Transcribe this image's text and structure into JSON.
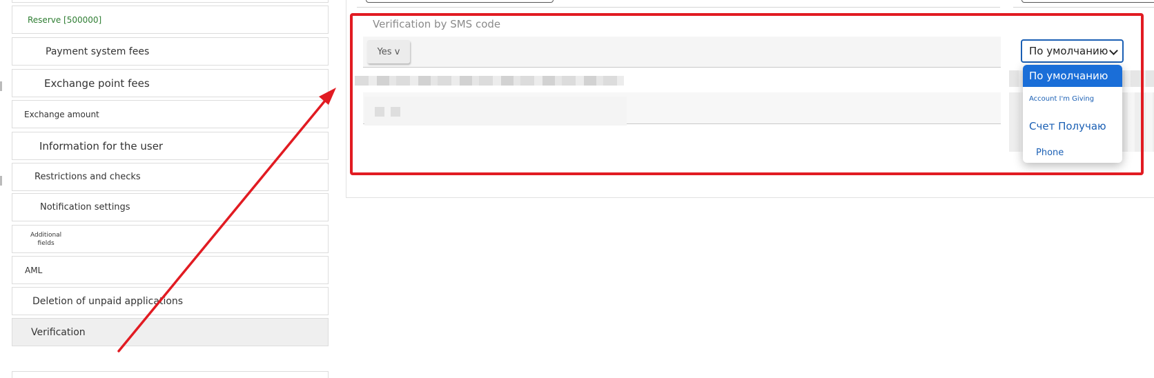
{
  "sidebar": {
    "items": [
      {
        "label": "Reserve [500000]",
        "color": "#2e7d32"
      },
      {
        "label": "Payment system fees"
      },
      {
        "label": "Exchange point fees"
      },
      {
        "label": "Exchange amount"
      },
      {
        "label": "Information for the user"
      },
      {
        "label": "Restrictions and checks"
      },
      {
        "label": "Notification settings"
      },
      {
        "label_line1": "Additional",
        "label_line2": "fields"
      },
      {
        "label": "AML"
      },
      {
        "label": "Deletion of unpaid applications"
      },
      {
        "label": "Verification",
        "active": true
      }
    ]
  },
  "main": {
    "field_title": "Verification by SMS code",
    "toggle_value": "Yes v",
    "select": {
      "value": "По умолчанию",
      "options": [
        {
          "label": "По умолчанию",
          "selected": true
        },
        {
          "label": "Account I'm Giving"
        },
        {
          "label": "Счет Получаю"
        },
        {
          "label": "Phone"
        }
      ]
    }
  },
  "colors": {
    "highlight_frame": "#e11b22",
    "accent": "#1a6ed8",
    "arrow": "#e11b22"
  }
}
